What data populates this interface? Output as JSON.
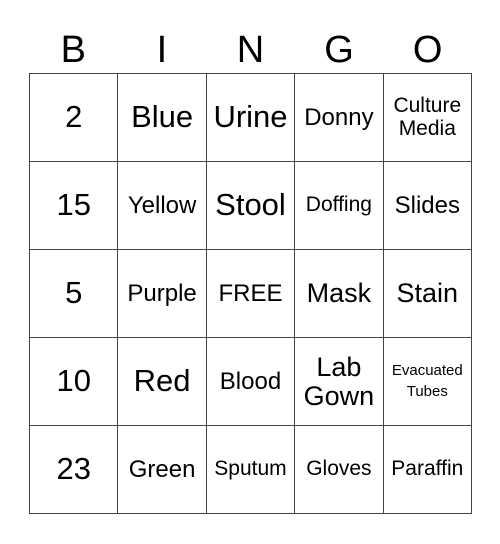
{
  "header": [
    "B",
    "I",
    "N",
    "G",
    "O"
  ],
  "cells": [
    [
      "2",
      "Blue",
      "Urine",
      "Donny",
      "Culture\nMedia"
    ],
    [
      "15",
      "Yellow",
      "Stool",
      "Doffing",
      "Slides"
    ],
    [
      "5",
      "Purple",
      "FREE",
      "Mask",
      "Stain"
    ],
    [
      "10",
      "Red",
      "Blood",
      "Lab\nGown",
      "Evacuated\nTubes"
    ],
    [
      "23",
      "Green",
      "Sputum",
      "Gloves",
      "Paraffin"
    ]
  ]
}
